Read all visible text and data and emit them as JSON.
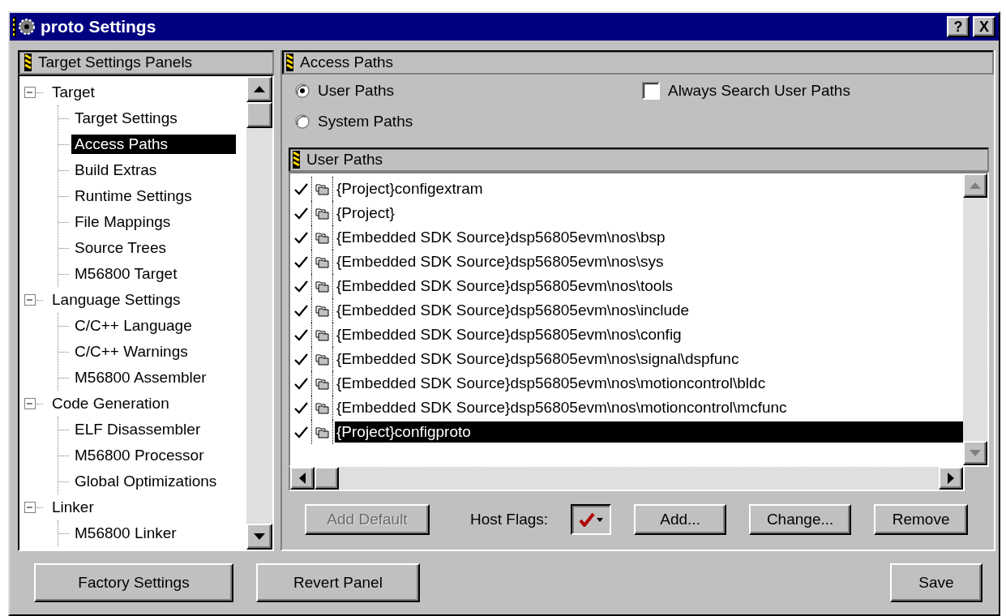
{
  "window": {
    "title": "proto Settings",
    "buttons": [
      "?",
      "X"
    ]
  },
  "sidebar": {
    "header": "Target Settings Panels",
    "tree": [
      {
        "label": "Target",
        "expanded": true,
        "children": [
          {
            "label": "Target Settings",
            "selected": false
          },
          {
            "label": "Access Paths",
            "selected": true
          },
          {
            "label": "Build Extras",
            "selected": false
          },
          {
            "label": "Runtime Settings",
            "selected": false
          },
          {
            "label": "File Mappings",
            "selected": false
          },
          {
            "label": "Source Trees",
            "selected": false
          },
          {
            "label": "M56800 Target",
            "selected": false
          }
        ]
      },
      {
        "label": "Language Settings",
        "expanded": true,
        "children": [
          {
            "label": "C/C++ Language",
            "selected": false
          },
          {
            "label": "C/C++ Warnings",
            "selected": false
          },
          {
            "label": "M56800 Assembler",
            "selected": false
          }
        ]
      },
      {
        "label": "Code Generation",
        "expanded": true,
        "children": [
          {
            "label": "ELF Disassembler",
            "selected": false
          },
          {
            "label": "M56800 Processor",
            "selected": false
          },
          {
            "label": "Global Optimizations",
            "selected": false
          }
        ]
      },
      {
        "label": "Linker",
        "expanded": true,
        "children": [
          {
            "label": "M56800 Linker",
            "selected": false
          }
        ]
      }
    ]
  },
  "panel": {
    "header": "Access Paths",
    "radios": [
      {
        "label": "User Paths",
        "selected": true
      },
      {
        "label": "System Paths",
        "selected": false
      }
    ],
    "checkbox": {
      "label": "Always Search User Paths",
      "checked": false
    },
    "list": {
      "header": "User Paths",
      "rows": [
        {
          "path": "{Project}configextram",
          "checked": true,
          "selected": false
        },
        {
          "path": "{Project}",
          "checked": true,
          "selected": false
        },
        {
          "path": "{Embedded SDK Source}dsp56805evm\\nos\\bsp",
          "checked": true,
          "selected": false
        },
        {
          "path": "{Embedded SDK Source}dsp56805evm\\nos\\sys",
          "checked": true,
          "selected": false
        },
        {
          "path": "{Embedded SDK Source}dsp56805evm\\nos\\tools",
          "checked": true,
          "selected": false
        },
        {
          "path": "{Embedded SDK Source}dsp56805evm\\nos\\include",
          "checked": true,
          "selected": false
        },
        {
          "path": "{Embedded SDK Source}dsp56805evm\\nos\\config",
          "checked": true,
          "selected": false
        },
        {
          "path": "{Embedded SDK Source}dsp56805evm\\nos\\signal\\dspfunc",
          "checked": true,
          "selected": false
        },
        {
          "path": "{Embedded SDK Source}dsp56805evm\\nos\\motioncontrol\\bldc",
          "checked": true,
          "selected": false
        },
        {
          "path": "{Embedded SDK Source}dsp56805evm\\nos\\motioncontrol\\mcfunc",
          "checked": true,
          "selected": false
        },
        {
          "path": "{Project}configproto",
          "checked": true,
          "selected": true
        }
      ]
    },
    "add_default": {
      "label": "Add Default",
      "disabled": true
    },
    "host_flags_label": "Host Flags:",
    "buttons": [
      "Add...",
      "Change...",
      "Remove"
    ]
  },
  "footer": {
    "left_buttons": [
      "Factory Settings",
      "Revert Panel"
    ],
    "right_buttons": [
      "Save"
    ]
  }
}
